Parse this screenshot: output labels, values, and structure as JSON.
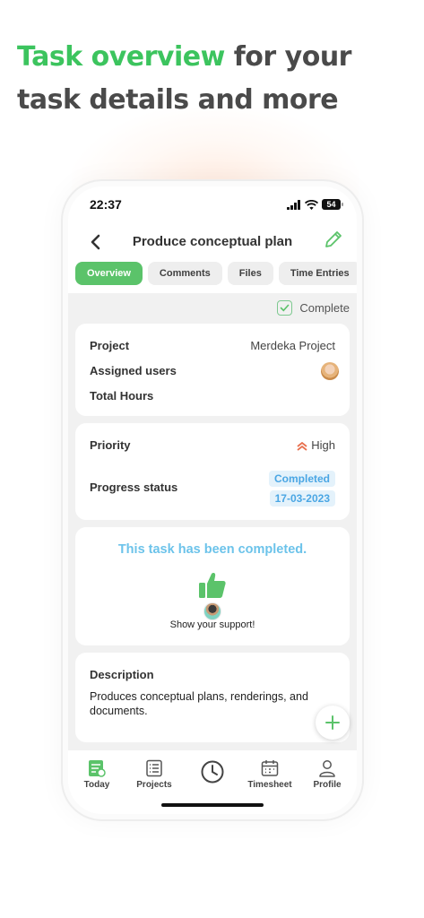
{
  "headline": {
    "accent": "Task overview",
    "rest_line1": " for your",
    "line2": "task details and more"
  },
  "status_bar": {
    "time": "22:37",
    "battery": "54"
  },
  "nav": {
    "title": "Produce conceptual plan"
  },
  "tabs": [
    {
      "label": "Overview",
      "active": true
    },
    {
      "label": "Comments",
      "active": false
    },
    {
      "label": "Files",
      "active": false
    },
    {
      "label": "Time Entries",
      "active": false
    }
  ],
  "complete_toggle": {
    "label": "Complete",
    "checked": true
  },
  "details": {
    "project_label": "Project",
    "project_value": "Merdeka Project",
    "assigned_label": "Assigned users",
    "hours_label": "Total Hours"
  },
  "status": {
    "priority_label": "Priority",
    "priority_value": "High",
    "progress_label": "Progress status",
    "progress_value": "Completed",
    "progress_date": "17-03-2023"
  },
  "completion": {
    "message": "This task has been completed.",
    "support": "Show your support!"
  },
  "description": {
    "title": "Description",
    "text": "Produces conceptual plans, renderings, and documents."
  },
  "bottom_nav": [
    {
      "label": "Today",
      "icon": "today-icon"
    },
    {
      "label": "Projects",
      "icon": "projects-icon"
    },
    {
      "label": "",
      "icon": "clock-icon"
    },
    {
      "label": "Timesheet",
      "icon": "calendar-icon"
    },
    {
      "label": "Profile",
      "icon": "profile-icon"
    }
  ],
  "colors": {
    "accent": "#3cc45e",
    "tab_active": "#5bc36a",
    "info": "#4aa6e4",
    "priority": "#e8704e"
  }
}
